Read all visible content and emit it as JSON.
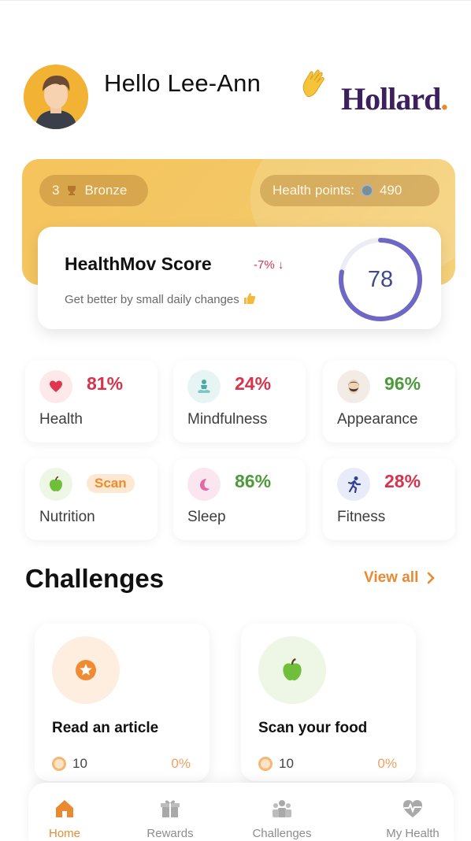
{
  "header": {
    "greeting": "Hello Lee-Ann",
    "logo_text": "Hollard",
    "logo_dot": "."
  },
  "banner": {
    "tier_count": "3",
    "tier_name": "Bronze",
    "points_label": "Health points:",
    "points_value": "490"
  },
  "score": {
    "title": "HealthMov Score",
    "change": "-7% ↓",
    "subtitle": "Get better by small daily changes",
    "value": "78",
    "value_fraction": 0.78
  },
  "stats": [
    {
      "label": "Health",
      "value": "81%",
      "icon": "heart-icon",
      "value_color": "red"
    },
    {
      "label": "Mindfulness",
      "value": "24%",
      "icon": "meditation-icon",
      "value_color": "red"
    },
    {
      "label": "Appearance",
      "value": "96%",
      "icon": "face-icon",
      "value_color": "green"
    },
    {
      "label": "Nutrition",
      "value": "Scan",
      "icon": "apple-icon",
      "value_color": "orange"
    },
    {
      "label": "Sleep",
      "value": "86%",
      "icon": "moon-icon",
      "value_color": "green"
    },
    {
      "label": "Fitness",
      "value": "28%",
      "icon": "running-icon",
      "value_color": "red"
    }
  ],
  "challenges": {
    "title": "Challenges",
    "view_all": "View all",
    "items": [
      {
        "name": "Read an article",
        "points": "10",
        "progress": "0%",
        "icon": "star-badge-icon"
      },
      {
        "name": "Scan your food",
        "points": "10",
        "progress": "0%",
        "icon": "apple-icon"
      }
    ]
  },
  "nav": {
    "items": [
      {
        "label": "Home",
        "icon": "home-icon",
        "active": true
      },
      {
        "label": "Rewards",
        "icon": "gift-icon",
        "active": false
      },
      {
        "label": "Challenges",
        "icon": "group-icon",
        "active": false
      },
      {
        "label": "My Health",
        "icon": "heartbeat-icon",
        "active": false
      }
    ]
  },
  "colors": {
    "accent": "#e98a33",
    "banner": "#f6c35c",
    "ring": "#6e68c4",
    "negative": "#d8334c",
    "positive": "#4c9a3a",
    "logo": "#3d1f5e"
  }
}
